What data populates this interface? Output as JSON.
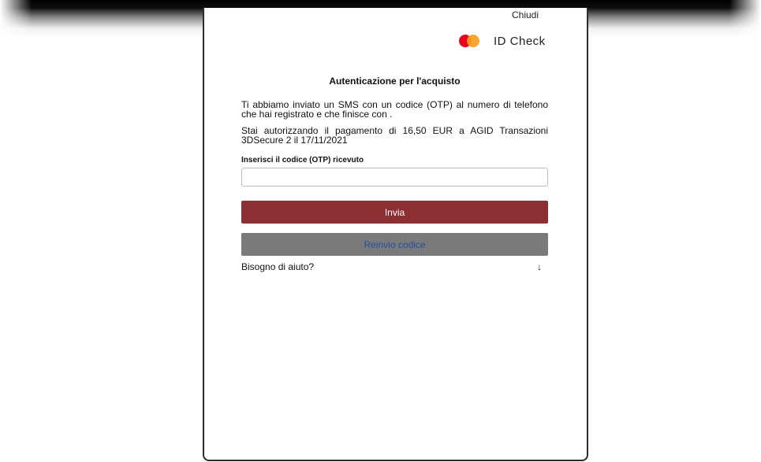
{
  "header": {
    "close_label": "Chiudi",
    "brand_text": "ID Check",
    "brand_icon": "mastercard-logo-icon",
    "brand_colors": {
      "red": "#eb001b",
      "orange": "#f79e1b"
    }
  },
  "main": {
    "title": "Autenticazione per l'acquisto",
    "sms_message": "Ti abbiamo inviato un SMS con un codice (OTP) al numero di telefono che hai registrato e che finisce con .",
    "payment_message": "Stai autorizzando il pagamento di 16,50 EUR a AGID Transazioni 3DSecure 2 il 17/11/2021",
    "otp_label": "Inserisci il codice (OTP) ricevuto",
    "otp_value": "",
    "otp_placeholder": "",
    "send_button": "Invia",
    "resend_button": "Reinvio codice",
    "help_label": "Bisogno di aiuto?",
    "help_icon": "↓"
  },
  "colors": {
    "send_button_bg": "#8c2f33",
    "resend_button_bg": "#7a7a7a",
    "resend_button_text": "#1f4fa3"
  }
}
